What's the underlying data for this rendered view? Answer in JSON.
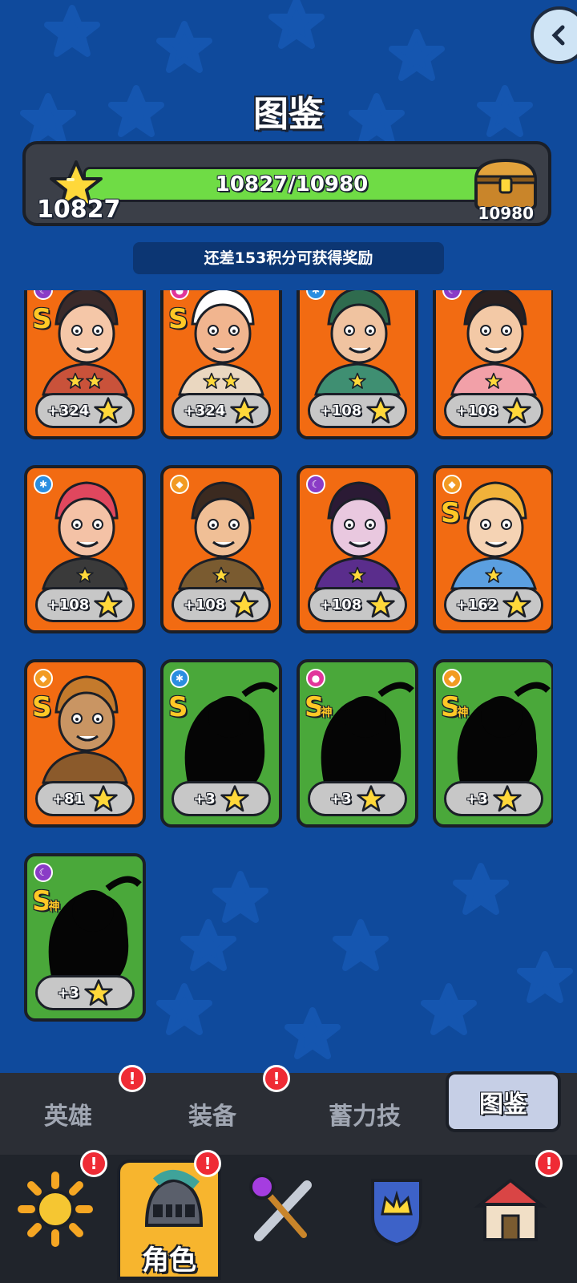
{
  "page": {
    "title": "图鉴"
  },
  "progress": {
    "current": 10827,
    "goal": 10980,
    "fraction": 0.986,
    "label": "10827/10980",
    "current_label": "10827",
    "goal_label": "10980"
  },
  "reward_message": "还差153积分可获得奖励",
  "cards": [
    {
      "bg": "orange",
      "element": "purple",
      "rank": "S",
      "god": "",
      "stars": 2,
      "points": "+324",
      "unlocked": true
    },
    {
      "bg": "orange",
      "element": "pink",
      "rank": "S",
      "god": "",
      "stars": 2,
      "points": "+324",
      "unlocked": true
    },
    {
      "bg": "orange",
      "element": "blue",
      "rank": "",
      "god": "",
      "stars": 1,
      "points": "+108",
      "unlocked": true
    },
    {
      "bg": "orange",
      "element": "purple",
      "rank": "",
      "god": "",
      "stars": 1,
      "points": "+108",
      "unlocked": true
    },
    {
      "bg": "orange",
      "element": "blue",
      "rank": "",
      "god": "",
      "stars": 1,
      "points": "+108",
      "unlocked": true
    },
    {
      "bg": "orange",
      "element": "orange",
      "rank": "",
      "god": "",
      "stars": 1,
      "points": "+108",
      "unlocked": true
    },
    {
      "bg": "orange",
      "element": "purple",
      "rank": "",
      "god": "",
      "stars": 1,
      "points": "+108",
      "unlocked": true
    },
    {
      "bg": "orange",
      "element": "orange",
      "rank": "S",
      "god": "",
      "stars": 1,
      "points": "+162",
      "unlocked": true
    },
    {
      "bg": "orange",
      "element": "orange",
      "rank": "S",
      "god": "",
      "stars": 0,
      "points": "+81",
      "unlocked": true
    },
    {
      "bg": "green",
      "element": "blue",
      "rank": "S",
      "god": "",
      "stars": 0,
      "points": "+3",
      "unlocked": false
    },
    {
      "bg": "green",
      "element": "pink",
      "rank": "S",
      "god": "神",
      "stars": 0,
      "points": "+3",
      "unlocked": false
    },
    {
      "bg": "green",
      "element": "orange",
      "rank": "S",
      "god": "神",
      "stars": 0,
      "points": "+3",
      "unlocked": false
    },
    {
      "bg": "green",
      "element": "purple",
      "rank": "S",
      "god": "神",
      "stars": 0,
      "points": "+3",
      "unlocked": false
    }
  ],
  "subtabs": [
    {
      "label": "英雄",
      "active": false,
      "badge": true
    },
    {
      "label": "装备",
      "active": false,
      "badge": true
    },
    {
      "label": "蓄力技",
      "active": false,
      "badge": false
    },
    {
      "label": "图鉴",
      "active": true,
      "badge": false
    }
  ],
  "bottom_nav": [
    {
      "icon": "sun-icon",
      "label": "",
      "active": false,
      "badge": true
    },
    {
      "icon": "helmet-icon",
      "label": "角色",
      "active": true,
      "badge": true
    },
    {
      "icon": "weapons-icon",
      "label": "",
      "active": false,
      "badge": false
    },
    {
      "icon": "crown-shield-icon",
      "label": "",
      "active": false,
      "badge": false
    },
    {
      "icon": "shop-icon",
      "label": "",
      "active": false,
      "badge": true
    }
  ],
  "colors": {
    "background": "#0f4a9c",
    "card_orange": "#f26b12",
    "card_green": "#4aa83a",
    "progress_fill": "#6fdc45",
    "nav_active": "#f7b52e",
    "badge": "#ef2b35"
  }
}
